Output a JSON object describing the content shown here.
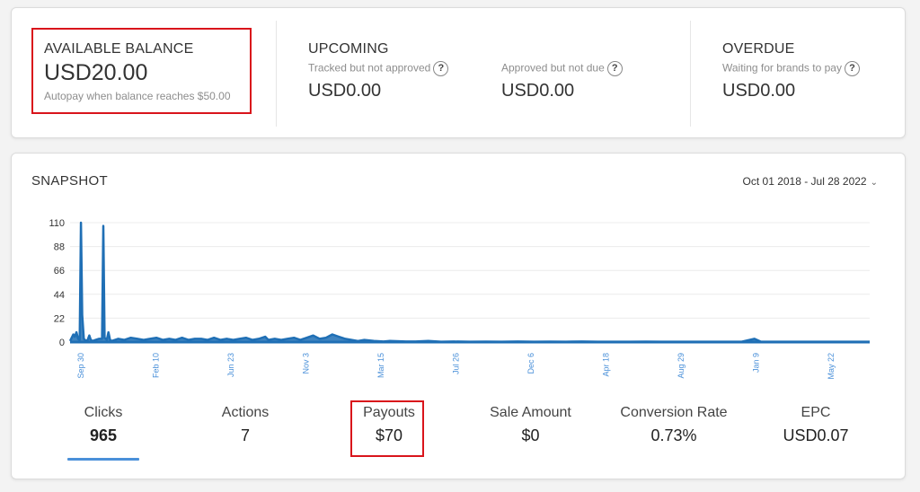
{
  "balance": {
    "available": {
      "title": "AVAILABLE BALANCE",
      "amount": "USD20.00",
      "note": "Autopay when balance reaches $50.00"
    },
    "upcoming": {
      "title": "UPCOMING",
      "tracked_label": "Tracked but not approved",
      "tracked_amount": "USD0.00",
      "approved_label": "Approved but not due",
      "approved_amount": "USD0.00"
    },
    "overdue": {
      "title": "OVERDUE",
      "label": "Waiting for brands to pay",
      "amount": "USD0.00"
    },
    "help_glyph": "?"
  },
  "snapshot": {
    "title": "SNAPSHOT",
    "date_range": "Oct 01 2018 - Jul 28 2022",
    "chevron": "⌄"
  },
  "chart_data": {
    "type": "area",
    "series_color": "#1f6fb5",
    "ylim": [
      0,
      110
    ],
    "y_ticks": [
      "110",
      "88",
      "66",
      "44",
      "22",
      "0"
    ],
    "x_tick_labels": [
      "Sep 30",
      "Feb 10",
      "Jun 23",
      "Nov 3",
      "Mar 15",
      "Jul 26",
      "Dec 6",
      "Apr 18",
      "Aug 29",
      "Jan 9",
      "May 22"
    ],
    "grid": true,
    "points": [
      [
        0,
        1
      ],
      [
        0.5,
        4
      ],
      [
        1,
        7
      ],
      [
        1.5,
        5
      ],
      [
        2,
        9
      ],
      [
        2.5,
        3
      ],
      [
        3,
        2
      ],
      [
        3.4,
        110
      ],
      [
        3.8,
        25
      ],
      [
        4.3,
        3
      ],
      [
        5,
        1
      ],
      [
        5.5,
        2
      ],
      [
        6,
        6
      ],
      [
        6.5,
        2
      ],
      [
        7,
        1
      ],
      [
        8,
        2
      ],
      [
        9,
        3
      ],
      [
        10,
        3
      ],
      [
        10.4,
        107
      ],
      [
        10.8,
        4
      ],
      [
        11.5,
        2
      ],
      [
        12,
        9
      ],
      [
        12.5,
        2
      ],
      [
        13,
        1
      ],
      [
        15,
        3
      ],
      [
        17,
        2
      ],
      [
        19,
        4
      ],
      [
        21,
        3
      ],
      [
        23,
        2
      ],
      [
        25,
        3
      ],
      [
        27,
        4
      ],
      [
        29,
        2
      ],
      [
        31,
        3
      ],
      [
        33,
        2
      ],
      [
        35,
        4
      ],
      [
        37,
        2
      ],
      [
        39,
        3
      ],
      [
        41,
        3
      ],
      [
        43,
        2
      ],
      [
        45,
        4
      ],
      [
        47,
        2
      ],
      [
        49,
        3
      ],
      [
        51,
        2
      ],
      [
        53,
        3
      ],
      [
        55,
        4
      ],
      [
        57,
        2
      ],
      [
        59,
        3
      ],
      [
        61,
        5
      ],
      [
        62,
        2
      ],
      [
        64,
        3
      ],
      [
        66,
        2
      ],
      [
        68,
        3
      ],
      [
        70,
        4
      ],
      [
        72,
        2
      ],
      [
        74,
        4
      ],
      [
        76,
        6
      ],
      [
        78,
        3
      ],
      [
        80,
        4
      ],
      [
        82,
        7
      ],
      [
        84,
        5
      ],
      [
        86,
        3
      ],
      [
        88,
        2
      ],
      [
        90,
        1
      ],
      [
        92,
        2
      ],
      [
        95,
        1
      ],
      [
        98,
        0.5
      ],
      [
        100,
        1
      ],
      [
        105,
        0.5
      ],
      [
        108,
        0.5
      ],
      [
        112,
        1
      ],
      [
        116,
        0.3
      ],
      [
        120,
        0.5
      ],
      [
        125,
        0.3
      ],
      [
        130,
        0.4
      ],
      [
        135,
        0.3
      ],
      [
        140,
        0.5
      ],
      [
        145,
        0.3
      ],
      [
        150,
        0.4
      ],
      [
        155,
        0.3
      ],
      [
        160,
        0.5
      ],
      [
        165,
        0.3
      ],
      [
        170,
        0.3
      ],
      [
        175,
        0.3
      ],
      [
        180,
        0.4
      ],
      [
        185,
        0.3
      ],
      [
        190,
        0.3
      ],
      [
        195,
        0.3
      ],
      [
        200,
        0.3
      ],
      [
        205,
        0.3
      ],
      [
        210,
        0.3
      ],
      [
        214,
        3
      ],
      [
        216,
        0.3
      ],
      [
        220,
        0.3
      ],
      [
        225,
        0.3
      ],
      [
        230,
        0.3
      ],
      [
        235,
        0.3
      ],
      [
        240,
        0.3
      ],
      [
        245,
        0.3
      ],
      [
        250,
        0.3
      ]
    ]
  },
  "stats": [
    {
      "label": "Clicks",
      "value": "965"
    },
    {
      "label": "Actions",
      "value": "7"
    },
    {
      "label": "Payouts",
      "value": "$70"
    },
    {
      "label": "Sale Amount",
      "value": "$0"
    },
    {
      "label": "Conversion Rate",
      "value": "0.73%"
    },
    {
      "label": "EPC",
      "value": "USD0.07"
    }
  ],
  "colors": {
    "highlight": "#d9141b",
    "accent": "#4a90d9",
    "series": "#1f6fb5"
  }
}
